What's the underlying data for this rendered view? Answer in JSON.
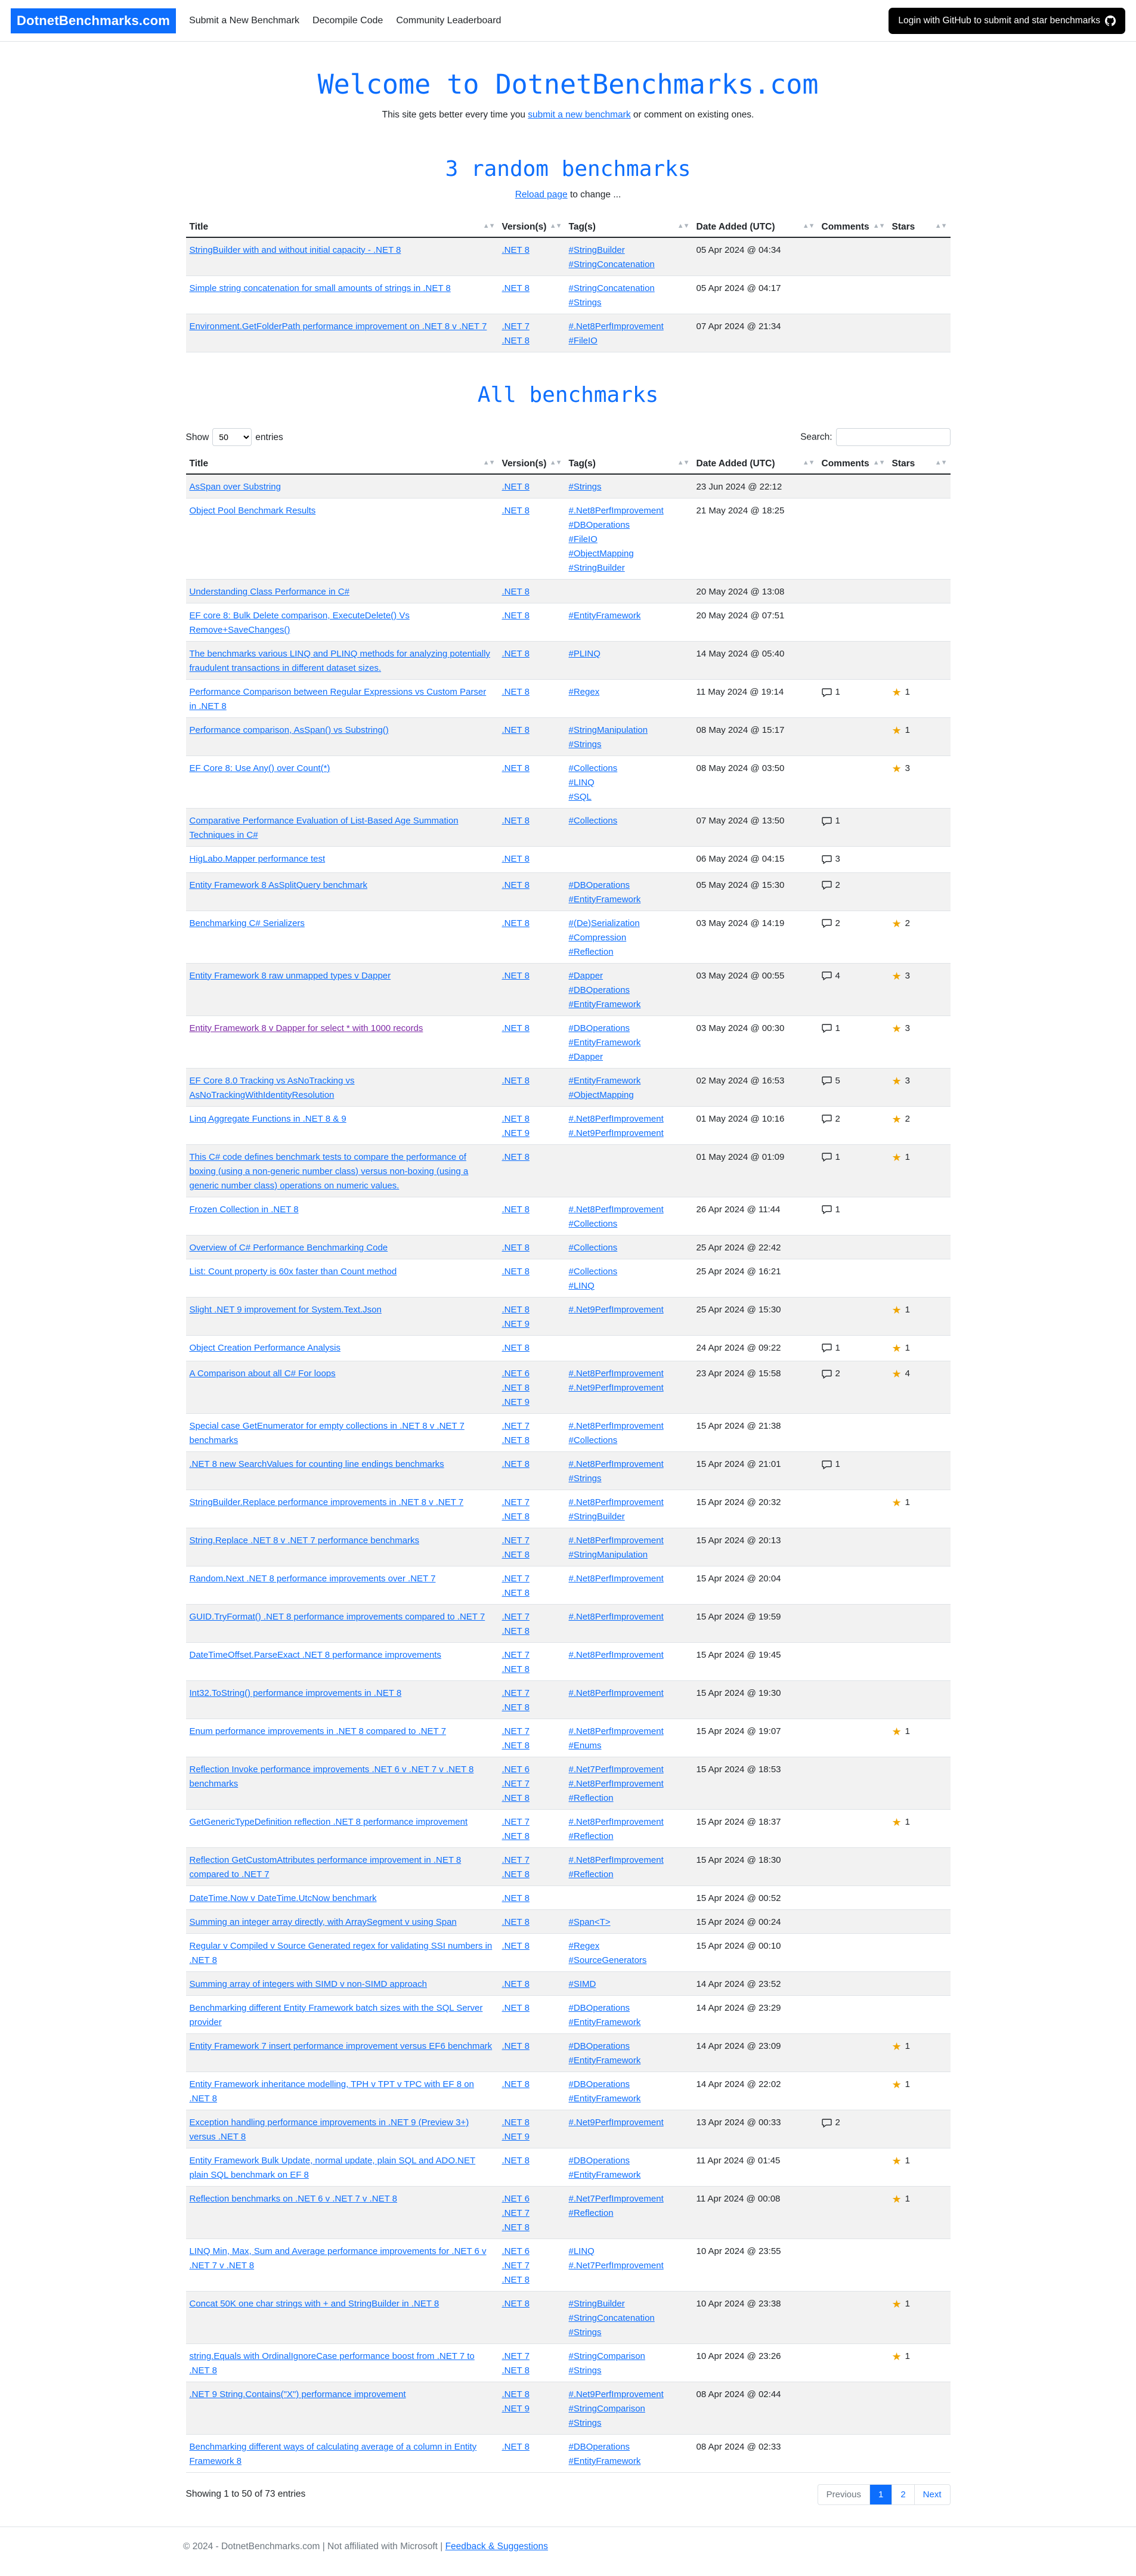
{
  "nav": {
    "brand_a": "Dotnet",
    "brand_b": "Benchmarks.com",
    "links": [
      "Submit a New Benchmark",
      "Decompile Code",
      "Community Leaderboard"
    ],
    "github_button": "Login with GitHub to submit and star benchmarks"
  },
  "hero": {
    "title": "Welcome to DotnetBenchmarks.com",
    "tagline_prefix": "This site gets better every time you",
    "tagline_link": "submit a new benchmark",
    "tagline_suffix": "or comment on existing ones."
  },
  "random": {
    "title": "3 random benchmarks",
    "reload_link": "Reload page",
    "reload_suffix": "to change ..."
  },
  "columns": [
    "Title",
    "Version(s)",
    "Tag(s)",
    "Date Added (UTC)",
    "Comments",
    "Stars"
  ],
  "random_rows": [
    {
      "title": "StringBuilder with and without initial capacity - .NET 8",
      "versions": [
        ".NET 8"
      ],
      "tags": [
        "#StringBuilder",
        "#StringConcatenation"
      ],
      "date": "05 Apr 2024 @ 04:34",
      "comments": "",
      "stars": ""
    },
    {
      "title": "Simple string concatenation for small amounts of strings in .NET 8",
      "versions": [
        ".NET 8"
      ],
      "tags": [
        "#StringConcatenation",
        "#Strings"
      ],
      "date": "05 Apr 2024 @ 04:17",
      "comments": "",
      "stars": ""
    },
    {
      "title": "Environment.GetFolderPath performance improvement on .NET 8 v .NET 7",
      "versions": [
        ".NET 7",
        ".NET 8"
      ],
      "tags": [
        "#.Net8PerfImprovement",
        "#FileIO"
      ],
      "date": "07 Apr 2024 @ 21:34",
      "comments": "",
      "stars": ""
    }
  ],
  "all": {
    "title": "All benchmarks",
    "show_label": "Show",
    "entries_label": "entries",
    "page_size": "50",
    "search_label": "Search:",
    "showing": "Showing 1 to 50 of 73 entries",
    "pager": [
      "Previous",
      "1",
      "2",
      "Next"
    ]
  },
  "all_rows": [
    {
      "title": "AsSpan over Substring",
      "versions": [
        ".NET 8"
      ],
      "tags": [
        "#Strings"
      ],
      "date": "23 Jun 2024 @ 22:12",
      "comments": "",
      "stars": ""
    },
    {
      "title": "Object Pool Benchmark Results",
      "versions": [
        ".NET 8"
      ],
      "tags": [
        "#.Net8PerfImprovement",
        "#DBOperations",
        "#FileIO",
        "#ObjectMapping",
        "#StringBuilder"
      ],
      "date": "21 May 2024 @ 18:25",
      "comments": "",
      "stars": ""
    },
    {
      "title": "Understanding Class Performance in C#",
      "versions": [
        ".NET 8"
      ],
      "tags": [],
      "date": "20 May 2024 @ 13:08",
      "comments": "",
      "stars": ""
    },
    {
      "title": "EF core 8: Bulk Delete comparison, ExecuteDelete() Vs Remove+SaveChanges()",
      "versions": [
        ".NET 8"
      ],
      "tags": [
        "#EntityFramework"
      ],
      "date": "20 May 2024 @ 07:51",
      "comments": "",
      "stars": ""
    },
    {
      "title": "The benchmarks various LINQ and PLINQ methods for analyzing potentially fraudulent transactions in different dataset sizes.",
      "versions": [
        ".NET 8"
      ],
      "tags": [
        "#PLINQ"
      ],
      "date": "14 May 2024 @ 05:40",
      "comments": "",
      "stars": ""
    },
    {
      "title": "Performance Comparison between Regular Expressions vs Custom Parser in .NET 8",
      "versions": [
        ".NET 8"
      ],
      "tags": [
        "#Regex"
      ],
      "date": "11 May 2024 @ 19:14",
      "comments": "1",
      "stars": "1"
    },
    {
      "title": "Performance comparison, AsSpan() vs Substring()",
      "versions": [
        ".NET 8"
      ],
      "tags": [
        "#StringManipulation",
        "#Strings"
      ],
      "date": "08 May 2024 @ 15:17",
      "comments": "",
      "stars": "1"
    },
    {
      "title": "EF Core 8: Use Any() over Count(*)",
      "versions": [
        ".NET 8"
      ],
      "tags": [
        "#Collections",
        "#LINQ",
        "#SQL"
      ],
      "date": "08 May 2024 @ 03:50",
      "comments": "",
      "stars": "3"
    },
    {
      "title": "Comparative Performance Evaluation of List-Based Age Summation Techniques in C#",
      "versions": [
        ".NET 8"
      ],
      "tags": [
        "#Collections"
      ],
      "date": "07 May 2024 @ 13:50",
      "comments": "1",
      "stars": ""
    },
    {
      "title": "HigLabo.Mapper performance test",
      "versions": [
        ".NET 8"
      ],
      "tags": [],
      "date": "06 May 2024 @ 04:15",
      "comments": "3",
      "stars": ""
    },
    {
      "title": "Entity Framework 8 AsSplitQuery benchmark",
      "versions": [
        ".NET 8"
      ],
      "tags": [
        "#DBOperations",
        "#EntityFramework"
      ],
      "date": "05 May 2024 @ 15:30",
      "comments": "2",
      "stars": ""
    },
    {
      "title": "Benchmarking C# Serializers",
      "versions": [
        ".NET 8"
      ],
      "tags": [
        "#(De)Serialization",
        "#Compression",
        "#Reflection"
      ],
      "date": "03 May 2024 @ 14:19",
      "comments": "2",
      "stars": "2"
    },
    {
      "title": "Entity Framework 8 raw unmapped types v Dapper",
      "versions": [
        ".NET 8"
      ],
      "tags": [
        "#Dapper",
        "#DBOperations",
        "#EntityFramework"
      ],
      "date": "03 May 2024 @ 00:55",
      "comments": "4",
      "stars": "3"
    },
    {
      "title": "Entity Framework 8 v Dapper for select * with 1000 records",
      "versions": [
        ".NET 8"
      ],
      "tags": [
        "#DBOperations",
        "#EntityFramework",
        "#Dapper"
      ],
      "date": "03 May 2024 @ 00:30",
      "comments": "1",
      "stars": "3",
      "visited": true
    },
    {
      "title": "EF Core 8.0 Tracking vs AsNoTracking vs AsNoTrackingWithIdentityResolution",
      "versions": [
        ".NET 8"
      ],
      "tags": [
        "#EntityFramework",
        "#ObjectMapping"
      ],
      "date": "02 May 2024 @ 16:53",
      "comments": "5",
      "stars": "3"
    },
    {
      "title": "Linq Aggregate Functions in .NET 8 & 9",
      "versions": [
        ".NET 8",
        ".NET 9"
      ],
      "tags": [
        "#.Net8PerfImprovement",
        "#.Net9PerfImprovement"
      ],
      "date": "01 May 2024 @ 10:16",
      "comments": "2",
      "stars": "2"
    },
    {
      "title": "This C# code defines benchmark tests to compare the performance of boxing (using a non-generic number class) versus non-boxing (using a generic number class) operations on numeric values.",
      "versions": [
        ".NET 8"
      ],
      "tags": [],
      "date": "01 May 2024 @ 01:09",
      "comments": "1",
      "stars": "1"
    },
    {
      "title": "Frozen Collection in .NET 8",
      "versions": [
        ".NET 8"
      ],
      "tags": [
        "#.Net8PerfImprovement",
        "#Collections"
      ],
      "date": "26 Apr 2024 @ 11:44",
      "comments": "1",
      "stars": ""
    },
    {
      "title": "Overview of C# Performance Benchmarking Code",
      "versions": [
        ".NET 8"
      ],
      "tags": [
        "#Collections"
      ],
      "date": "25 Apr 2024 @ 22:42",
      "comments": "",
      "stars": ""
    },
    {
      "title": "List: Count property is 60x faster than Count method",
      "versions": [
        ".NET 8"
      ],
      "tags": [
        "#Collections",
        "#LINQ"
      ],
      "date": "25 Apr 2024 @ 16:21",
      "comments": "",
      "stars": ""
    },
    {
      "title": "Slight .NET 9 improvement for System.Text.Json",
      "versions": [
        ".NET 8",
        ".NET 9"
      ],
      "tags": [
        "#.Net9PerfImprovement"
      ],
      "date": "25 Apr 2024 @ 15:30",
      "comments": "",
      "stars": "1"
    },
    {
      "title": "Object Creation Performance Analysis",
      "versions": [
        ".NET 8"
      ],
      "tags": [],
      "date": "24 Apr 2024 @ 09:22",
      "comments": "1",
      "stars": "1"
    },
    {
      "title": "A Comparison about all C# For loops",
      "versions": [
        ".NET 6",
        ".NET 8",
        ".NET 9"
      ],
      "tags": [
        "#.Net8PerfImprovement",
        "#.Net9PerfImprovement"
      ],
      "date": "23 Apr 2024 @ 15:58",
      "comments": "2",
      "stars": "4"
    },
    {
      "title": "Special case GetEnumerator for empty collections in .NET 8 v .NET 7 benchmarks",
      "versions": [
        ".NET 7",
        ".NET 8"
      ],
      "tags": [
        "#.Net8PerfImprovement",
        "#Collections"
      ],
      "date": "15 Apr 2024 @ 21:38",
      "comments": "",
      "stars": ""
    },
    {
      "title": ".NET 8 new SearchValues for counting line endings benchmarks",
      "versions": [
        ".NET 8"
      ],
      "tags": [
        "#.Net8PerfImprovement",
        "#Strings"
      ],
      "date": "15 Apr 2024 @ 21:01",
      "comments": "1",
      "stars": ""
    },
    {
      "title": "StringBuilder.Replace performance improvements in .NET 8 v .NET 7",
      "versions": [
        ".NET 7",
        ".NET 8"
      ],
      "tags": [
        "#.Net8PerfImprovement",
        "#StringBuilder"
      ],
      "date": "15 Apr 2024 @ 20:32",
      "comments": "",
      "stars": "1"
    },
    {
      "title": "String.Replace .NET 8 v .NET 7 performance benchmarks",
      "versions": [
        ".NET 7",
        ".NET 8"
      ],
      "tags": [
        "#.Net8PerfImprovement",
        "#StringManipulation"
      ],
      "date": "15 Apr 2024 @ 20:13",
      "comments": "",
      "stars": ""
    },
    {
      "title": "Random.Next .NET 8 performance improvements over .NET 7",
      "versions": [
        ".NET 7",
        ".NET 8"
      ],
      "tags": [
        "#.Net8PerfImprovement"
      ],
      "date": "15 Apr 2024 @ 20:04",
      "comments": "",
      "stars": ""
    },
    {
      "title": "GUID.TryFormat() .NET 8 performance improvements compared to .NET 7",
      "versions": [
        ".NET 7",
        ".NET 8"
      ],
      "tags": [
        "#.Net8PerfImprovement"
      ],
      "date": "15 Apr 2024 @ 19:59",
      "comments": "",
      "stars": ""
    },
    {
      "title": "DateTimeOffset.ParseExact .NET 8 performance improvements",
      "versions": [
        ".NET 7",
        ".NET 8"
      ],
      "tags": [
        "#.Net8PerfImprovement"
      ],
      "date": "15 Apr 2024 @ 19:45",
      "comments": "",
      "stars": ""
    },
    {
      "title": "Int32.ToString() performance improvements in .NET 8",
      "versions": [
        ".NET 7",
        ".NET 8"
      ],
      "tags": [
        "#.Net8PerfImprovement"
      ],
      "date": "15 Apr 2024 @ 19:30",
      "comments": "",
      "stars": ""
    },
    {
      "title": "Enum performance improvements in .NET 8 compared to .NET 7",
      "versions": [
        ".NET 7",
        ".NET 8"
      ],
      "tags": [
        "#.Net8PerfImprovement",
        "#Enums"
      ],
      "date": "15 Apr 2024 @ 19:07",
      "comments": "",
      "stars": "1"
    },
    {
      "title": "Reflection Invoke performance improvements .NET 6 v .NET 7 v .NET 8 benchmarks",
      "versions": [
        ".NET 6",
        ".NET 7",
        ".NET 8"
      ],
      "tags": [
        "#.Net7PerfImprovement",
        "#.Net8PerfImprovement",
        "#Reflection"
      ],
      "date": "15 Apr 2024 @ 18:53",
      "comments": "",
      "stars": ""
    },
    {
      "title": "GetGenericTypeDefinition reflection .NET 8 performance improvement",
      "versions": [
        ".NET 7",
        ".NET 8"
      ],
      "tags": [
        "#.Net8PerfImprovement",
        "#Reflection"
      ],
      "date": "15 Apr 2024 @ 18:37",
      "comments": "",
      "stars": "1"
    },
    {
      "title": "Reflection GetCustomAttributes performance improvement in .NET 8 compared to .NET 7",
      "versions": [
        ".NET 7",
        ".NET 8"
      ],
      "tags": [
        "#.Net8PerfImprovement",
        "#Reflection"
      ],
      "date": "15 Apr 2024 @ 18:30",
      "comments": "",
      "stars": ""
    },
    {
      "title": "DateTime.Now v DateTime.UtcNow benchmark",
      "versions": [
        ".NET 8"
      ],
      "tags": [],
      "date": "15 Apr 2024 @ 00:52",
      "comments": "",
      "stars": ""
    },
    {
      "title": "Summing an integer array directly, with ArraySegment v using Span",
      "versions": [
        ".NET 8"
      ],
      "tags": [
        "#Span<T>"
      ],
      "date": "15 Apr 2024 @ 00:24",
      "comments": "",
      "stars": ""
    },
    {
      "title": "Regular v Compiled v Source Generated regex for validating SSI numbers in .NET 8",
      "versions": [
        ".NET 8"
      ],
      "tags": [
        "#Regex",
        "#SourceGenerators"
      ],
      "date": "15 Apr 2024 @ 00:10",
      "comments": "",
      "stars": ""
    },
    {
      "title": "Summing array of integers with SIMD v non-SIMD approach",
      "versions": [
        ".NET 8"
      ],
      "tags": [
        "#SIMD"
      ],
      "date": "14 Apr 2024 @ 23:52",
      "comments": "",
      "stars": ""
    },
    {
      "title": "Benchmarking different Entity Framework batch sizes with the SQL Server provider",
      "versions": [
        ".NET 8"
      ],
      "tags": [
        "#DBOperations",
        "#EntityFramework"
      ],
      "date": "14 Apr 2024 @ 23:29",
      "comments": "",
      "stars": ""
    },
    {
      "title": "Entity Framework 7 insert performance improvement versus EF6 benchmark",
      "versions": [
        ".NET 8"
      ],
      "tags": [
        "#DBOperations",
        "#EntityFramework"
      ],
      "date": "14 Apr 2024 @ 23:09",
      "comments": "",
      "stars": "1"
    },
    {
      "title": "Entity Framework inheritance modelling, TPH v TPT v TPC with EF 8 on .NET 8",
      "versions": [
        ".NET 8"
      ],
      "tags": [
        "#DBOperations",
        "#EntityFramework"
      ],
      "date": "14 Apr 2024 @ 22:02",
      "comments": "",
      "stars": "1"
    },
    {
      "title": "Exception handling performance improvements in .NET 9 (Preview 3+) versus .NET 8",
      "versions": [
        ".NET 8",
        ".NET 9"
      ],
      "tags": [
        "#.Net9PerfImprovement"
      ],
      "date": "13 Apr 2024 @ 00:33",
      "comments": "2",
      "stars": ""
    },
    {
      "title": "Entity Framework Bulk Update, normal update, plain SQL and ADO.NET plain SQL benchmark on EF 8",
      "versions": [
        ".NET 8"
      ],
      "tags": [
        "#DBOperations",
        "#EntityFramework"
      ],
      "date": "11 Apr 2024 @ 01:45",
      "comments": "",
      "stars": "1"
    },
    {
      "title": "Reflection benchmarks on .NET 6 v .NET 7 v .NET 8",
      "versions": [
        ".NET 6",
        ".NET 7",
        ".NET 8"
      ],
      "tags": [
        "#.Net7PerfImprovement",
        "#Reflection"
      ],
      "date": "11 Apr 2024 @ 00:08",
      "comments": "",
      "stars": "1"
    },
    {
      "title": "LINQ Min, Max, Sum and Average performance improvements for .NET 6 v .NET 7 v .NET 8",
      "versions": [
        ".NET 6",
        ".NET 7",
        ".NET 8"
      ],
      "tags": [
        "#LINQ",
        "#.Net7PerfImprovement"
      ],
      "date": "10 Apr 2024 @ 23:55",
      "comments": "",
      "stars": ""
    },
    {
      "title": "Concat 50K one char strings with + and StringBuilder in .NET 8",
      "versions": [
        ".NET 8"
      ],
      "tags": [
        "#StringBuilder",
        "#StringConcatenation",
        "#Strings"
      ],
      "date": "10 Apr 2024 @ 23:38",
      "comments": "",
      "stars": "1"
    },
    {
      "title": "string.Equals with OrdinalIgnoreCase performance boost from .NET 7 to .NET 8",
      "versions": [
        ".NET 7",
        ".NET 8"
      ],
      "tags": [
        "#StringComparison",
        "#Strings"
      ],
      "date": "10 Apr 2024 @ 23:26",
      "comments": "",
      "stars": "1"
    },
    {
      "title": ".NET 9 String.Contains(\"X\") performance improvement",
      "versions": [
        ".NET 8",
        ".NET 9"
      ],
      "tags": [
        "#.Net9PerfImprovement",
        "#StringComparison",
        "#Strings"
      ],
      "date": "08 Apr 2024 @ 02:44",
      "comments": "",
      "stars": ""
    },
    {
      "title": "Benchmarking different ways of calculating average of a column in Entity Framework 8",
      "versions": [
        ".NET 8"
      ],
      "tags": [
        "#DBOperations",
        "#EntityFramework"
      ],
      "date": "08 Apr 2024 @ 02:33",
      "comments": "",
      "stars": ""
    }
  ],
  "footer": {
    "text": "© 2024 - DotnetBenchmarks.com | Not affiliated with Microsoft |",
    "link": "Feedback & Suggestions"
  },
  "colors": {
    "accent": "#0d6efd",
    "star": "#f0a500",
    "visited": "#7f2aa6"
  }
}
